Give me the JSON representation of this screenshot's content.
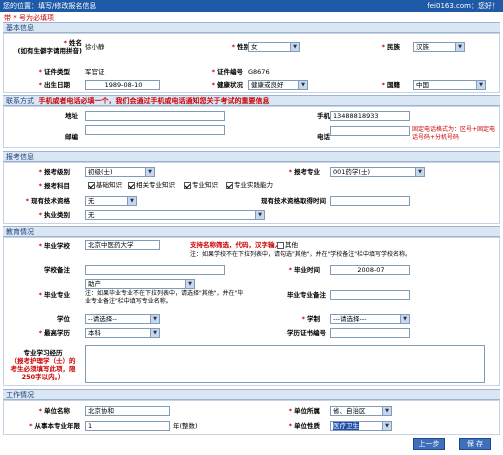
{
  "topbar": {
    "left": "您的位置：填写/修改报名信息",
    "right": "fei0163.com：您好！"
  },
  "required_note": "带 * 号为必填项",
  "sections": {
    "basic": "基本信息",
    "contact": "联系方式",
    "contact_note": "手机或者电话必填一个，我们会通过手机或电话通知您关于考试的重要信息",
    "exam": "报考信息",
    "education": "教育情况",
    "work": "工作情况"
  },
  "basic": {
    "name_label": "姓名",
    "name_note": "(如有生僻字请用拼音)",
    "name_value": "徐小静",
    "gender_label": "性别",
    "gender_value": "女",
    "ethnicity_label": "民族",
    "ethnicity_value": "汉族",
    "idtype_label": "证件类型",
    "idtype_value": "军官证",
    "idno_label": "证件编号",
    "idno_value": "G8676",
    "birth_label": "出生日期",
    "birth_value": "1989-08-10",
    "health_label": "健康状况",
    "health_value": "健康或良好",
    "nation_label": "国籍",
    "nation_value": "中国"
  },
  "contact": {
    "address_label": "地址",
    "address_value": "",
    "mobile_label": "手机",
    "mobile_value": "13488818933",
    "postcode_label": "邮编",
    "postcode_value": "",
    "phone_label": "电话",
    "phone_value": "",
    "phone_hint": "固定电话格式为：区号+固定电话号码+分机号码"
  },
  "exam": {
    "level_label": "报考级别",
    "level_value": "初级(士)",
    "major_label": "报考专业",
    "major_value": "001药学(士)",
    "subjects_label": "报考科目",
    "subjects": [
      {
        "label": "基础知识",
        "checked": true
      },
      {
        "label": "相关专业知识",
        "checked": true
      },
      {
        "label": "专业知识",
        "checked": true
      },
      {
        "label": "专业实践能力",
        "checked": true
      }
    ],
    "techqual_label": "现有技术资格",
    "techqual_value": "无",
    "techtime_label": "现有技术资格取得时间",
    "techtime_value": "",
    "practice_label": "执业类别",
    "practice_value": "无"
  },
  "education": {
    "school_label": "毕业学校",
    "school_value": "北京中医药大学",
    "school_hint": "支持名称筛选，代码，汉字输入",
    "other_label": "其他",
    "school_note": "注：如果学校不在下拉列表中，请勾选\"其他\"，并在\"学校备注\"栏中填写学校名称。",
    "school_remark_label": "学校备注",
    "school_remark_value": "",
    "gradtime_label": "毕业时间",
    "gradtime_value": "2008-07",
    "major_label": "毕业专业",
    "major_value": "助产",
    "major_note": "注：如果毕业专业不在下拉列表中，请选择\"其他\"，并在\"毕业专业备注\"栏中填写专业名称。",
    "major_remark_label": "毕业专业备注",
    "major_remark_value": "",
    "degree_label": "学位",
    "degree_value": "--请选择--",
    "system_label": "学制",
    "system_value": "---请选择---",
    "edu_label": "最高学历",
    "edu_value": "本科",
    "cert_label": "学历证书编号",
    "cert_value": "",
    "resume_label": "专业学习经历",
    "resume_note": "（报考护理学（士）的考生必须填写此项，限250字以内。）",
    "resume_value": ""
  },
  "work": {
    "unit_label": "单位名称",
    "unit_value": "北京协和",
    "region_label": "单位所属",
    "region_value": "省、自治区",
    "years_label": "从事本专业年限",
    "years_value": "1",
    "years_unit": "年(整数)",
    "nature_label": "单位性质",
    "nature_value": "医疗卫生"
  },
  "buttons": {
    "prev": "上一步",
    "save": "保 存"
  }
}
